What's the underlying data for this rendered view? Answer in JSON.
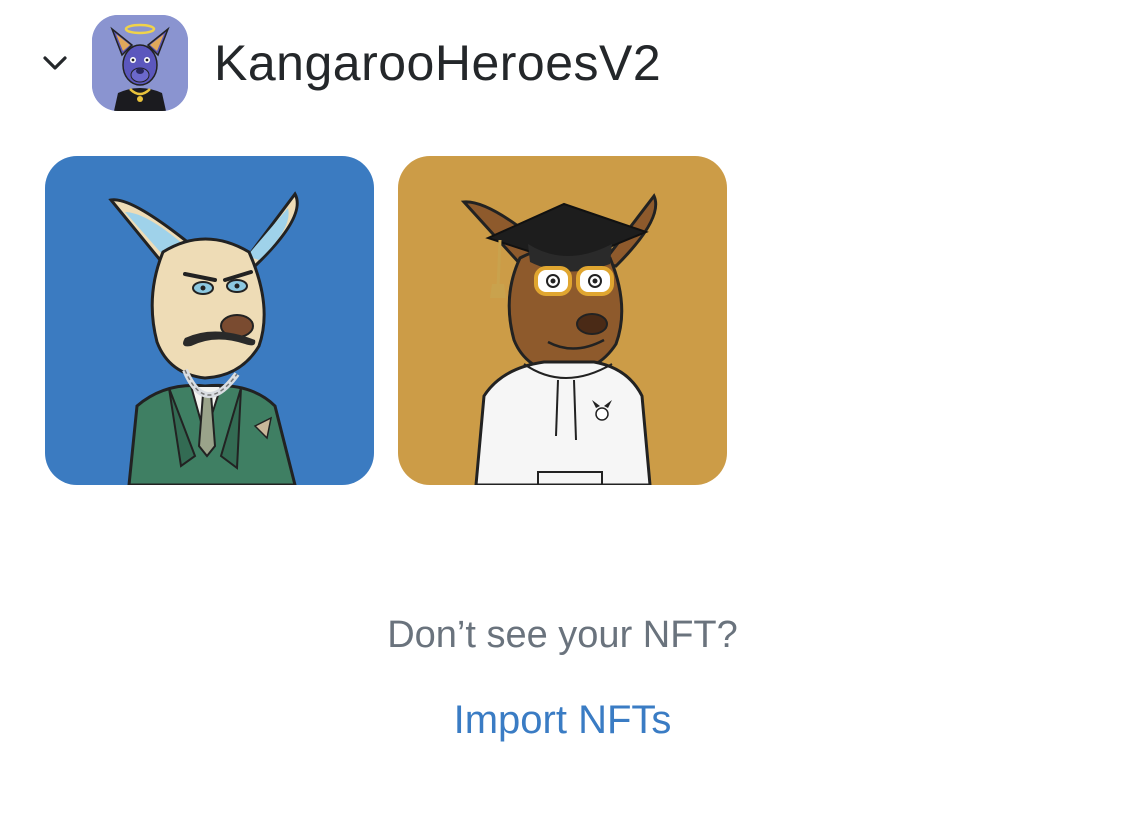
{
  "collection": {
    "name": "KangarooHeroesV2",
    "expanded": true,
    "avatar_icon": "kangaroo-halo-avatar",
    "avatar_bg": "#8a94d0"
  },
  "nfts": [
    {
      "icon": "kangaroo-suit-nft",
      "bg": "#3b7bc1"
    },
    {
      "icon": "kangaroo-graduate-nft",
      "bg": "#cc9c47"
    }
  ],
  "empty_state": {
    "hint": "Don’t see your NFT?",
    "import_label": "Import NFTs"
  },
  "colors": {
    "text_primary": "#24272a",
    "text_muted": "#6a737d",
    "link": "#3a7cc4"
  }
}
